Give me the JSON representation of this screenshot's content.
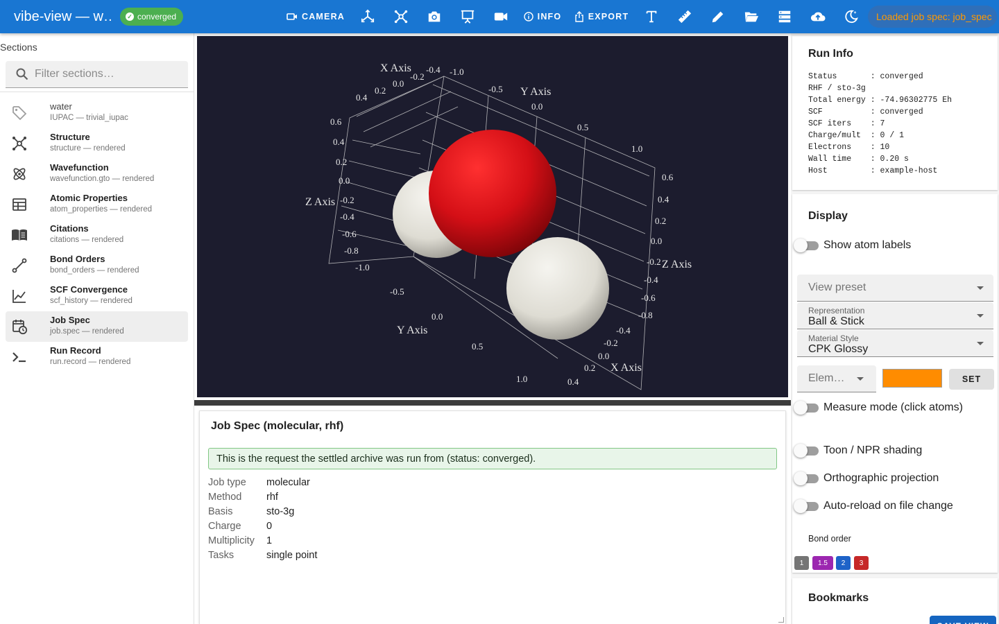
{
  "app": {
    "title": "vibe-view — w…",
    "status_chip": "converged",
    "loaded_chip": "Loaded job spec: job_spec"
  },
  "toolbar": {
    "camera_label": "CAMERA",
    "info_label": "INFO",
    "export_label": "EXPORT",
    "icons": [
      "axes-icon",
      "molecule-icon",
      "camera-snapshot-icon",
      "presentation-icon",
      "video-icon",
      "text-icon",
      "ruler-icon",
      "pencil-icon",
      "folder-open-icon",
      "server-icon",
      "cloud-upload-icon",
      "theme-night-icon"
    ]
  },
  "sidebar": {
    "title": "Sections",
    "filter_placeholder": "Filter sections…",
    "items": [
      {
        "label": "water",
        "sub": "IUPAC — trivial_iupac",
        "icon": "tag-icon"
      },
      {
        "label": "Structure",
        "sub": "structure — rendered",
        "icon": "molecule-icon"
      },
      {
        "label": "Wavefunction",
        "sub": "wavefunction.gto — rendered",
        "icon": "atom-icon"
      },
      {
        "label": "Atomic Properties",
        "sub": "atom_properties — rendered",
        "icon": "table-icon"
      },
      {
        "label": "Citations",
        "sub": "citations — rendered",
        "icon": "book-icon"
      },
      {
        "label": "Bond Orders",
        "sub": "bond_orders — rendered",
        "icon": "bond-icon"
      },
      {
        "label": "SCF Convergence",
        "sub": "scf_history — rendered",
        "icon": "chart-line-icon"
      },
      {
        "label": "Job Spec",
        "sub": "job.spec — rendered",
        "icon": "calendar-clock-icon"
      },
      {
        "label": "Run Record",
        "sub": "run.record — rendered",
        "icon": "console-icon"
      }
    ]
  },
  "viewer": {
    "axis_titles": {
      "x": "X Axis",
      "y": "Y Axis",
      "z": "Z Axis"
    },
    "ticks": {
      "x_top": [
        "0.4",
        "0.2",
        "0.0",
        "-0.2",
        "-0.4",
        "-1.0"
      ],
      "y_top": [
        "-0.5",
        "0.0",
        "0.5",
        "1.0"
      ],
      "z_left": [
        "0.6",
        "0.4",
        "0.2",
        "0.0",
        "-0.2",
        "-0.4",
        "-0.6",
        "-0.8",
        "-1.0"
      ],
      "y_bottom": [
        "-0.5",
        "0.0",
        "0.5",
        "1.0"
      ],
      "z_right": [
        "0.6",
        "0.4",
        "0.2",
        "0.0",
        "-0.2",
        "-0.4",
        "-0.6",
        "-0.8"
      ],
      "x_bottom": [
        "-0.4",
        "-0.2",
        "0.0",
        "0.2",
        "0.4"
      ]
    },
    "background": "#1c1c2e",
    "oxygen_color": "#e8141c",
    "hydrogen_color": "#ecebe4"
  },
  "job_spec": {
    "title": "Job Spec (molecular, rhf)",
    "alert": "This is the request the settled archive was run from (status: converged).",
    "rows": [
      {
        "key": "Job type",
        "value": "molecular"
      },
      {
        "key": "Method",
        "value": "rhf"
      },
      {
        "key": "Basis",
        "value": "sto-3g"
      },
      {
        "key": "Charge",
        "value": "0"
      },
      {
        "key": "Multiplicity",
        "value": "1"
      },
      {
        "key": "Tasks",
        "value": "single point"
      }
    ]
  },
  "run_info": {
    "title": "Run Info",
    "text": "Status       : converged\nRHF / sto-3g\nTotal energy : -74.96302775 Eh\nSCF          : converged\nSCF iters    : 7\nCharge/mult  : 0 / 1\nElectrons    : 10\nWall time    : 0.20 s\nHost         : example-host"
  },
  "display": {
    "title": "Display",
    "show_atom_labels": "Show atom labels",
    "view_preset_placeholder": "View preset",
    "representation_label": "Representation",
    "representation_value": "Ball & Stick",
    "material_label": "Material Style",
    "material_value": "CPK Glossy",
    "element_placeholder": "Elem…",
    "swatch_color": "#ff8c00",
    "set_label": "SET",
    "measure_mode": "Measure mode (click atoms)",
    "toon_shading": "Toon / NPR shading",
    "orthographic": "Orthographic projection",
    "auto_reload": "Auto-reload on file change",
    "bond_order_label": "Bond order",
    "bond_chips": [
      {
        "label": "1",
        "color": "#757575"
      },
      {
        "label": "1.5",
        "color": "#9c27b0"
      },
      {
        "label": "2",
        "color": "#1e63c8"
      },
      {
        "label": "3",
        "color": "#c62828"
      }
    ]
  },
  "bookmarks": {
    "title": "Bookmarks",
    "save_label": "SAVE VIEW"
  }
}
